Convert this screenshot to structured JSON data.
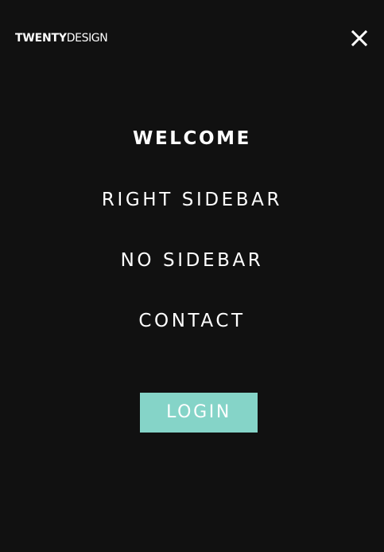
{
  "brand": {
    "bold_part": "TWENTY",
    "light_part": "DESIGN"
  },
  "close_icon": "close-icon",
  "menu": {
    "items": [
      {
        "label": "WELCOME",
        "active": true
      },
      {
        "label": "RIGHT SIDEBAR",
        "active": false
      },
      {
        "label": "NO SIDEBAR",
        "active": false
      },
      {
        "label": "CONTACT",
        "active": false
      }
    ]
  },
  "login": {
    "label": "LOGIN",
    "color": "#85d4c8"
  },
  "colors": {
    "background": "#111111",
    "text": "#ffffff",
    "accent": "#85d4c8"
  }
}
